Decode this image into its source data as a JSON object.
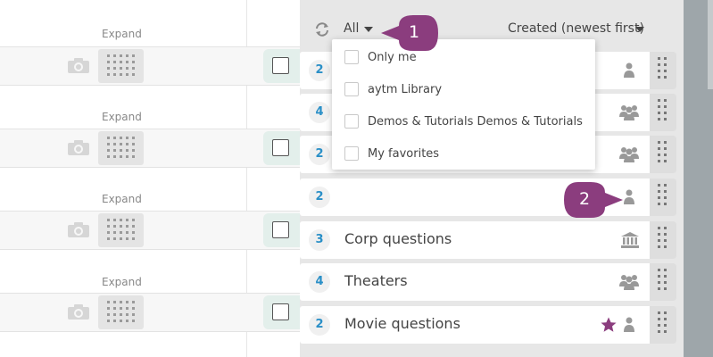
{
  "left_pane": {
    "expand_label": "Expand",
    "rows": 4
  },
  "toolbar": {
    "filter_label": "All",
    "sort_label": "Created (newest first)"
  },
  "dropdown": {
    "options": [
      {
        "label": "Only me",
        "checked": false
      },
      {
        "label": "aytm Library",
        "checked": false
      },
      {
        "label": "Demos & Tutorials Demos & Tutorials",
        "checked": false
      },
      {
        "label": "My favorites",
        "checked": false
      }
    ]
  },
  "list": {
    "rows": [
      {
        "count": "2",
        "title": "",
        "owner_icon": "person-icon",
        "favorite": false
      },
      {
        "count": "4",
        "title": "",
        "owner_icon": "group-icon",
        "favorite": false
      },
      {
        "count": "2",
        "title": "",
        "owner_icon": "group-icon",
        "favorite": false
      },
      {
        "count": "2",
        "title": "",
        "owner_icon": "person-icon",
        "favorite": false
      },
      {
        "count": "3",
        "title": "Corp questions",
        "owner_icon": "library-icon",
        "favorite": false
      },
      {
        "count": "4",
        "title": "Theaters",
        "owner_icon": "group-icon",
        "favorite": false
      },
      {
        "count": "2",
        "title": "Movie questions",
        "owner_icon": "person-icon",
        "favorite": true
      }
    ]
  },
  "callouts": [
    {
      "number": "1"
    },
    {
      "number": "2"
    }
  ],
  "colors": {
    "accent_badge": "#2a8fc7",
    "callout": "#8b3d7e",
    "favorite_star": "#8b3d7e",
    "checkbox_bg": "#e3efeb"
  }
}
